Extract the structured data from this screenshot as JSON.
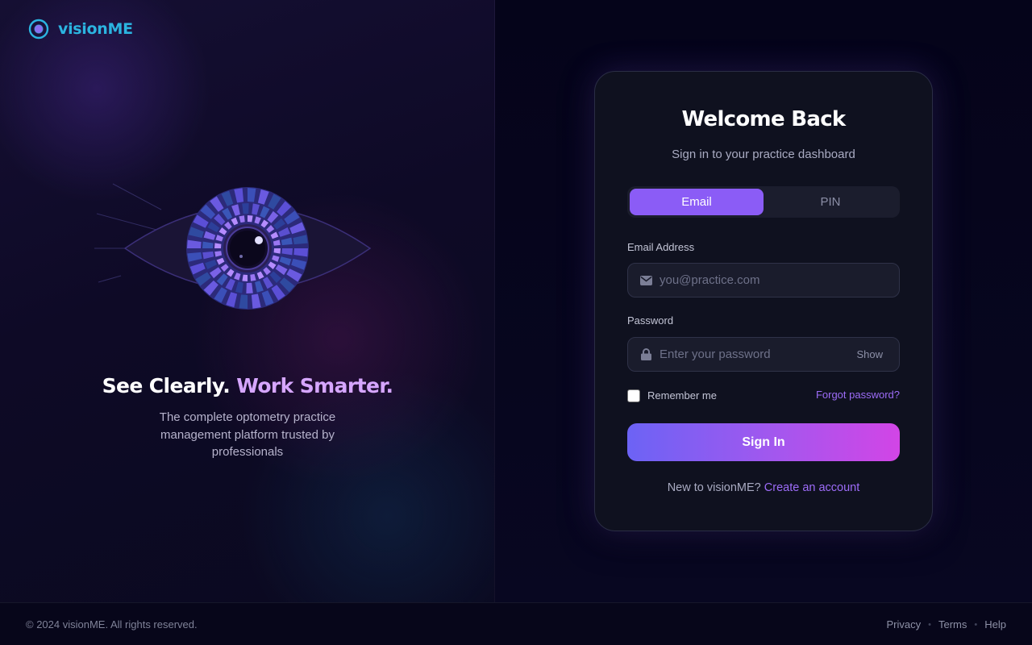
{
  "brand": {
    "name": "visionME",
    "color": "#2bb4e0"
  },
  "hero": {
    "headline_part1": "See Clearly.",
    "headline_part2": "Work Smarter.",
    "subtitle": "The complete optometry practice management platform trusted by professionals"
  },
  "login": {
    "title": "Welcome Back",
    "subtitle": "Sign in to your practice dashboard",
    "tabs": [
      {
        "label": "Email",
        "active": true
      },
      {
        "label": "PIN",
        "active": false
      }
    ],
    "email_label": "Email Address",
    "email_placeholder": "you@practice.com",
    "email_value": "",
    "password_label": "Password",
    "password_placeholder": "Enter your password",
    "password_value": "",
    "show_label": "Show",
    "remember_label": "Remember me",
    "remember_checked": false,
    "forgot_label": "Forgot password?",
    "submit_label": "Sign In",
    "signup_prompt": "New to visionME?",
    "signup_link": "Create an account"
  },
  "footer": {
    "copyright": "© 2024 visionME. All rights reserved.",
    "links": [
      "Privacy",
      "Terms",
      "Help"
    ]
  },
  "icons": {
    "brand": "target-eye-icon",
    "email": "envelope-icon",
    "password": "lock-icon",
    "hero_art": "eye-iris-illustration"
  },
  "colors": {
    "accent_purple": "#8b5cf6",
    "link_purple": "#9d6cf8",
    "button_gradient_start": "#6c63f5",
    "button_gradient_end": "#d245e6",
    "card_bg": "#0f111f",
    "page_bg": "#07061a"
  }
}
